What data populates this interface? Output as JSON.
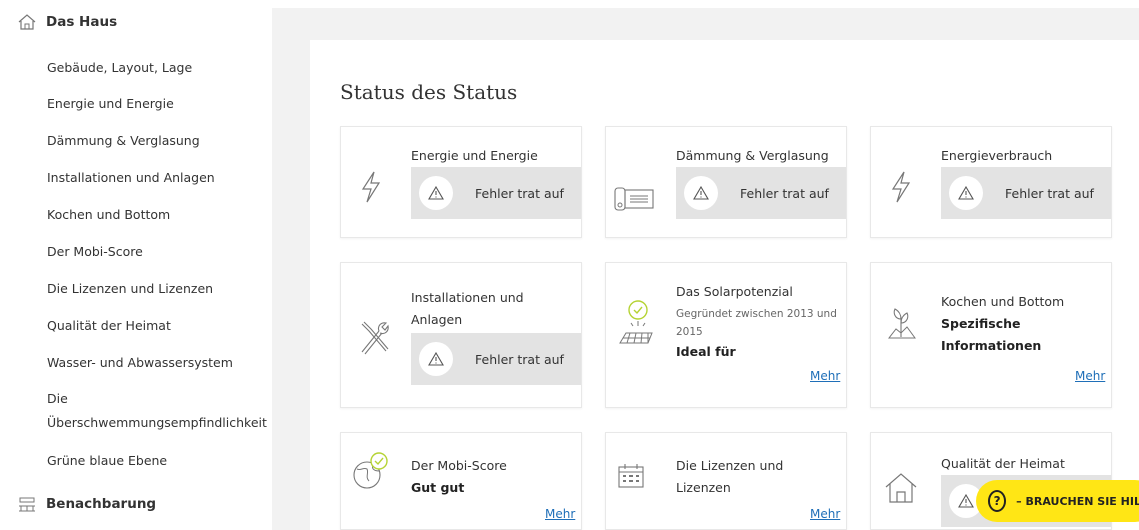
{
  "sidebar": {
    "section_house": "Das Haus",
    "items": [
      "Gebäude, Layout, Lage",
      "Energie und Energie",
      "Dämmung & Verglasung",
      "Installationen und Anlagen",
      "Kochen und Bottom",
      "Der Mobi-Score",
      "Die Lizenzen und Lizenzen",
      "Qualität der Heimat",
      "Wasser- und Abwassersystem",
      "Die",
      "Überschwemmungsempfindlichkeit",
      "Grüne blaue Ebene"
    ],
    "section_neighborhood": "Benachbarung"
  },
  "main": {
    "title": "Status des Status",
    "error_text": "Fehler trat auf",
    "more_label": "Mehr",
    "cards": {
      "energy": {
        "title": "Energie und Energie",
        "icon": "lightning-icon"
      },
      "insulation": {
        "title": "Dämmung & Verglasung",
        "icon": "window-insulation-icon"
      },
      "consumption": {
        "title": "Energieverbrauch",
        "icon": "lightning-icon"
      },
      "installations": {
        "title_line1": "Installationen und",
        "title_line2": "Anlagen",
        "icon": "tools-icon"
      },
      "solar": {
        "title": "Das Solarpotenzial",
        "sub_line1": "Gegründet zwischen 2013 und",
        "sub_line2": "2015",
        "bold": "Ideal für",
        "icon": "solar-panel-icon"
      },
      "cooking": {
        "title": "Kochen und Bottom",
        "bold_line1": "Spezifische",
        "bold_line2": "Informationen",
        "icon": "plant-icon"
      },
      "mobi": {
        "title": "Der Mobi-Score",
        "bold": "Gut gut",
        "icon": "globe-check-icon"
      },
      "licenses": {
        "title_line1": "Die Lizenzen und",
        "title_line2": "Lizenzen",
        "icon": "calendar-icon"
      },
      "quality": {
        "title": "Qualität der Heimat",
        "icon": "house-icon"
      }
    }
  },
  "help": {
    "label": "– BRAUCHEN SIE HILFE",
    "icon_glyph": "?"
  },
  "colors": {
    "accent_green": "#b5d334",
    "link_blue": "#1f6fb8",
    "help_yellow": "#ffe615",
    "error_bg": "#e3e3e3"
  }
}
